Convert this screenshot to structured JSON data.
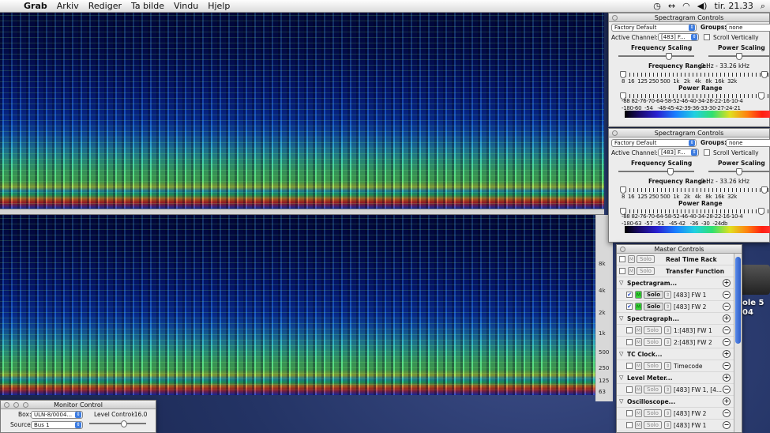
{
  "menubar": {
    "app": "Grab",
    "items": [
      "Arkiv",
      "Rediger",
      "Ta bilde",
      "Vindu",
      "Hjelp"
    ],
    "clock": "tir. 21.33"
  },
  "axis_bottom": [
    "8k",
    "4k",
    "2k",
    "1k",
    "500",
    "250",
    "125",
    "63"
  ],
  "spectrogram_controls": [
    {
      "title": "Spectragram Controls",
      "preset": "Factory Default",
      "groups_label": "Groups:",
      "groups_value": "none",
      "active_channel_label": "Active Channel:",
      "active_channel": "[483] F...",
      "scroll_vertically": "Scroll Vertically",
      "frequency_scaling": "Frequency Scaling",
      "power_scaling": "Power Scaling",
      "frequency_range_label": "Frequency Range:",
      "frequency_range": "0 Hz - 33.26 kHz",
      "freq_ticks": "8  16  125 250 500  1k   2k   4k   8k  16k  32k",
      "power_range_label": "Power Range",
      "power_ticks_top": "-88 82-76-70-64-58-52-46-40-34-28-22-16-10-4",
      "power_ticks_bottom": "-180-60  -54   -48-45-42-39-36-33-30-27-24-21"
    },
    {
      "title": "Spectragram Controls",
      "preset": "Factory Default",
      "groups_label": "Groups:",
      "groups_value": "none",
      "active_channel_label": "Active Channel:",
      "active_channel": "[483] F...",
      "scroll_vertically": "Scroll Vertically",
      "frequency_scaling": "Frequency Scaling",
      "power_scaling": "Power Scaling",
      "frequency_range_label": "Frequency Range:",
      "frequency_range": "0 Hz - 33.26 kHz",
      "freq_ticks": "8  16  125 250 500  1k   2k   4k   8k  16k  32k",
      "power_range_label": "Power Range",
      "power_ticks_top": "-88 82-76-70-64-58-52-46-40-34-28-22-16-10-4",
      "power_ticks_bottom": "-180-63  -57  -51   -45-42   -36  -30  -24db"
    }
  ],
  "master": {
    "title": "Master Controls",
    "top_rows": [
      {
        "solo": "Solo",
        "name": "Real Time Rack"
      },
      {
        "solo": "Solo",
        "name": "Transfer Function"
      }
    ],
    "groups": [
      {
        "name": "Spectragram...",
        "items": [
          {
            "name": "[483] FW 1",
            "checked": true,
            "active": true
          },
          {
            "name": "[483] FW 2",
            "checked": true,
            "active": true
          }
        ]
      },
      {
        "name": "Spectragraph...",
        "items": [
          {
            "name": "1:[483] FW 1",
            "checked": false,
            "active": false
          },
          {
            "name": "2:[483] FW 2",
            "checked": false,
            "active": false
          }
        ]
      },
      {
        "name": "TC Clock...",
        "items": [
          {
            "name": "Timecode",
            "checked": false,
            "active": false
          }
        ]
      },
      {
        "name": "Level Meter...",
        "items": [
          {
            "name": "[483] FW 1, [4...",
            "checked": false,
            "active": false
          }
        ]
      },
      {
        "name": "Oscilloscope...",
        "items": [
          {
            "name": "[483] FW 2",
            "checked": false,
            "active": false
          },
          {
            "name": "[483] FW 1",
            "checked": false,
            "active": false
          }
        ]
      }
    ],
    "solo_label": "Solo",
    "mute_label": "M"
  },
  "monitor": {
    "title": "Monitor Control",
    "box_label": "Box:",
    "box_value": "ULN-8/0004...",
    "level_label": "Level Control:",
    "level_value": "-16.0",
    "source_label": "Source:",
    "source_value": "Bus 1"
  },
  "desktop_label": {
    "line1": "ole 5",
    "line2": "04"
  },
  "colors": {
    "accent": "#3d7ce0",
    "solo_on": "#3ad83a"
  }
}
